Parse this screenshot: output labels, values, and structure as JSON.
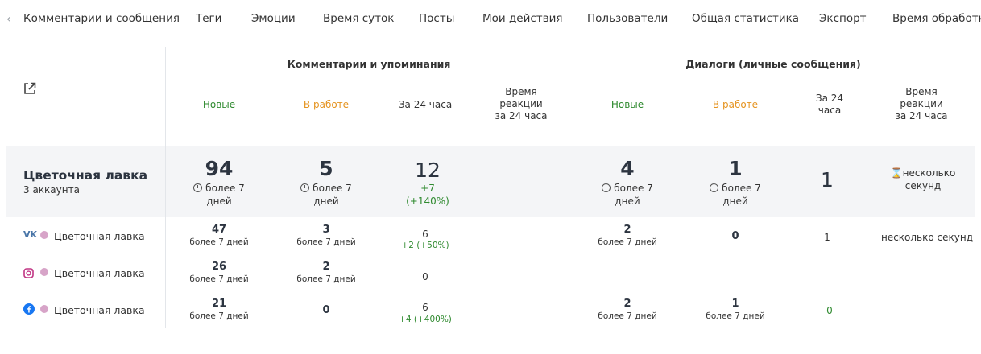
{
  "tabs": [
    "Комментарии и сообщения",
    "Теги",
    "Эмоции",
    "Время суток",
    "Посты",
    "Мои действия",
    "Пользователи",
    "Общая статистика",
    "Экспорт",
    "Время обработки"
  ],
  "groups": {
    "comments": "Комментарии и упоминания",
    "dialogs": "Диалоги (личные сообщения)"
  },
  "cols": {
    "c_new": "Новые",
    "c_work": "В работе",
    "c_24": "За 24 часа",
    "c_react": "Время\nреакции\nза 24 часа",
    "d_new": "Новые",
    "d_work": "В работе",
    "d_24": "За 24\nчаса",
    "d_react": "Время\nреакции\nза 24 часа"
  },
  "summary": {
    "name": "Цветочная лавка",
    "accounts": "3 аккаунта",
    "c_new": "94",
    "c_new_sub": "более 7\nдней",
    "c_work": "5",
    "c_work_sub": "более 7\nдней",
    "c_24": "12",
    "c_24_delta": "+7\n(+140%)",
    "d_new": "4",
    "d_new_sub": "более 7\nдней",
    "d_work": "1",
    "d_work_sub": "более 7\nдней",
    "d_24": "1",
    "d_react": "несколько\nсекунд"
  },
  "rows": [
    {
      "network": "vk",
      "name": "Цветочная лавка",
      "c_new": "47",
      "c_new_sub": "более 7 дней",
      "c_work": "3",
      "c_work_sub": "более 7 дней",
      "c_24": "6",
      "c_24_delta": "+2 (+50%)",
      "d_new": "2",
      "d_new_sub": "более 7 дней",
      "d_work": "0",
      "d_24": "1",
      "d_react": "несколько секунд"
    },
    {
      "network": "instagram",
      "name": "Цветочная лавка",
      "c_new": "26",
      "c_new_sub": "более 7 дней",
      "c_work": "2",
      "c_work_sub": "более 7 дней",
      "c_24": "0"
    },
    {
      "network": "facebook",
      "name": "Цветочная лавка",
      "c_new": "21",
      "c_new_sub": "более 7 дней",
      "c_work": "0",
      "c_24": "6",
      "c_24_delta": "+4 (+400%)",
      "d_new": "2",
      "d_new_sub": "более 7 дней",
      "d_work": "1",
      "d_work_sub": "более 7 дней",
      "d_24": "0"
    }
  ],
  "colors": {
    "green": "#2f8a2f",
    "orange": "#e59421",
    "vk": "#4a76a8",
    "instagram": "#c13584",
    "facebook": "#1877f2"
  }
}
